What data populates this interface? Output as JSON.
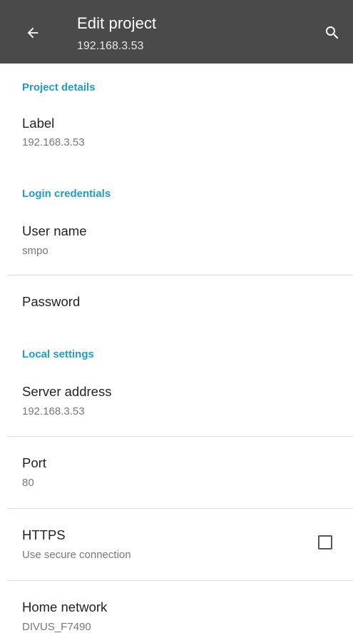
{
  "appbar": {
    "title": "Edit project",
    "subtitle": "192.168.3.53",
    "background": "#4a4a4a"
  },
  "icons": {
    "back": "arrow-left-icon",
    "search": "search-icon"
  },
  "sections": {
    "project_details": "Project details",
    "login_credentials": "Login credentials",
    "local_settings": "Local settings"
  },
  "prefs": {
    "label": {
      "title": "Label",
      "summary": "192.168.3.53"
    },
    "user_name": {
      "title": "User name",
      "summary": "smpo"
    },
    "password": {
      "title": "Password"
    },
    "server_address": {
      "title": "Server address",
      "summary": "192.168.3.53"
    },
    "port": {
      "title": "Port",
      "summary": "80"
    },
    "https": {
      "title": "HTTPS",
      "summary": "Use secure connection",
      "checked": false
    },
    "home_network": {
      "title": "Home network",
      "summary": "DIVUS_F7490"
    }
  },
  "colors": {
    "accent": "#1f9ccf",
    "title_text": "#222222",
    "summary_text": "#777777",
    "divider": "#dddddd"
  }
}
